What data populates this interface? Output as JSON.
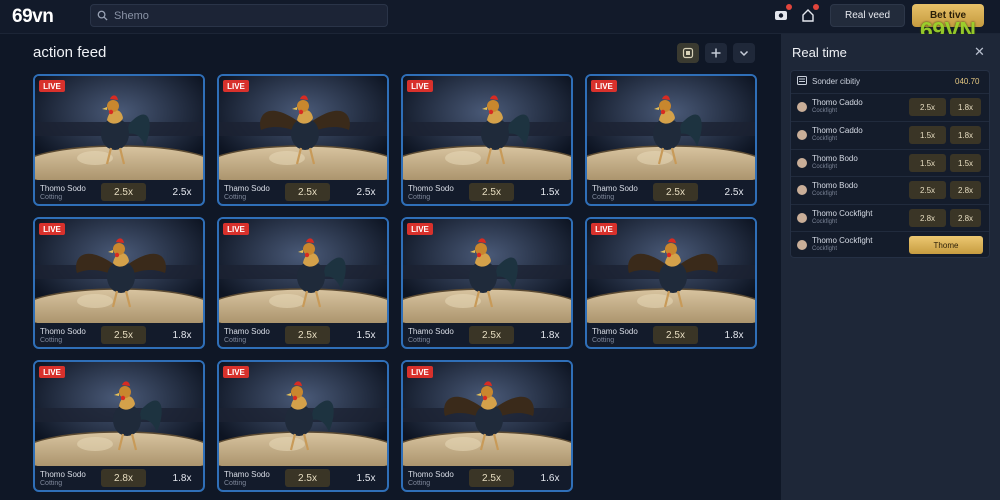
{
  "header": {
    "logo": "69vn",
    "search_placeholder": "Shemo",
    "real_button": "Real veed",
    "bet_button": "Bet tive",
    "watermark": "69VN"
  },
  "main": {
    "title": "action feed"
  },
  "colors": {
    "live_badge": "#d8312c",
    "accent_gold": "#e7c169",
    "card_border": "#2f6fb8"
  },
  "cards": [
    {
      "badge": "LIVE",
      "name": "Thomo Sodo",
      "sub": "Cotting",
      "odd1": "2.5x",
      "odd2": "2.5x"
    },
    {
      "badge": "LIVE",
      "name": "Thamo Sodo",
      "sub": "Cotting",
      "odd1": "2.5x",
      "odd2": "2.5x"
    },
    {
      "badge": "LIVE",
      "name": "Thomo Sodo",
      "sub": "Cotting",
      "odd1": "2.5x",
      "odd2": "1.5x"
    },
    {
      "badge": "LIVE",
      "name": "Thamo Sodo",
      "sub": "Cotting",
      "odd1": "2.5x",
      "odd2": "2.5x"
    },
    {
      "badge": "LIVE",
      "name": "Thomo Sodo",
      "sub": "Cotting",
      "odd1": "2.5x",
      "odd2": "1.8x"
    },
    {
      "badge": "LIVE",
      "name": "Thamo Sodo",
      "sub": "Cotting",
      "odd1": "2.5x",
      "odd2": "1.5x"
    },
    {
      "badge": "LIVE",
      "name": "Thamo Sodo",
      "sub": "Cotting",
      "odd1": "2.5x",
      "odd2": "1.8x"
    },
    {
      "badge": "LIVE",
      "name": "Thamo Sodo",
      "sub": "Cotting",
      "odd1": "2.5x",
      "odd2": "1.8x"
    },
    {
      "badge": "LIVE",
      "name": "Thomo Sodo",
      "sub": "Cotting",
      "odd1": "2.8x",
      "odd2": "1.8x"
    },
    {
      "badge": "LIVE",
      "name": "Thamo Sodo",
      "sub": "Cotting",
      "odd1": "2.5x",
      "odd2": "1.5x"
    },
    {
      "badge": "LIVE",
      "name": "Thomo Sodo",
      "sub": "Cotting",
      "odd1": "2.5x",
      "odd2": "1.6x"
    }
  ],
  "realtime": {
    "title": "Real time",
    "close": "✕",
    "header_label": "Sonder cibitiy",
    "header_value": "040.70",
    "rows": [
      {
        "name": "Thomo Caddo",
        "sub": "Cockfight",
        "odd1": "2.5x",
        "odd2": "1.8x"
      },
      {
        "name": "Thomo Caddo",
        "sub": "Cockfight",
        "odd1": "1.5x",
        "odd2": "1.8x"
      },
      {
        "name": "Thomo Bodo",
        "sub": "Cockfight",
        "odd1": "1.5x",
        "odd2": "1.5x"
      },
      {
        "name": "Thomo Bodo",
        "sub": "Cockfight",
        "odd1": "2.5x",
        "odd2": "2.8x"
      },
      {
        "name": "Thomo Cockfight",
        "sub": "Cockfight",
        "odd1": "2.8x",
        "odd2": "2.8x"
      },
      {
        "name": "Thomo Cockfight",
        "sub": "Cockfight",
        "theme": "Thome"
      }
    ]
  }
}
